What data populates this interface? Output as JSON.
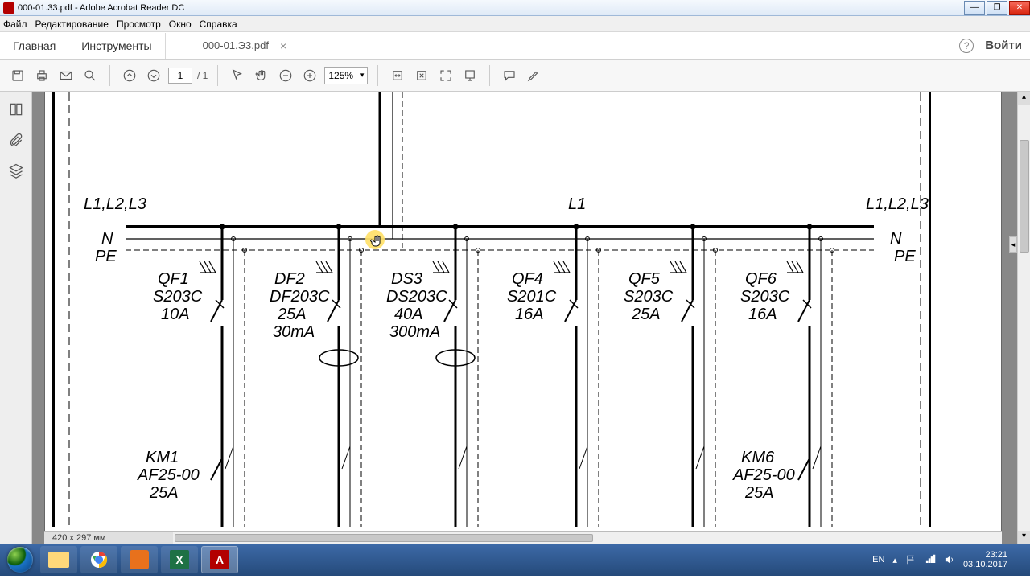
{
  "window": {
    "title": "000-01.33.pdf - Adobe Acrobat Reader DC"
  },
  "menu": {
    "file": "Файл",
    "edit": "Редактирование",
    "view": "Просмотр",
    "window": "Окно",
    "help": "Справка"
  },
  "tabs": {
    "home": "Главная",
    "tools": "Инструменты",
    "doc": "000-01.Э3.pdf",
    "login": "Войти"
  },
  "toolbar": {
    "page_current": "1",
    "page_total": "/ 1",
    "zoom": "125%"
  },
  "status": {
    "dimensions": "420 x 297 мм"
  },
  "diagram": {
    "phase_left": "L1,L2,L3",
    "neutral": "N",
    "ground": "PE",
    "phase_mid": "L1",
    "phase_right": "L1,L2,L3",
    "branches": [
      {
        "lab1": "QF1",
        "lab2": "S203C",
        "lab3": "10A",
        "lab4": ""
      },
      {
        "lab1": "DF2",
        "lab2": "DF203C",
        "lab3": "25A",
        "lab4": "30mA"
      },
      {
        "lab1": "DS3",
        "lab2": "DS203C",
        "lab3": "40A",
        "lab4": "300mA"
      },
      {
        "lab1": "QF4",
        "lab2": "S201C",
        "lab3": "16A",
        "lab4": ""
      },
      {
        "lab1": "QF5",
        "lab2": "S203C",
        "lab3": "25A",
        "lab4": ""
      },
      {
        "lab1": "QF6",
        "lab2": "S203C",
        "lab3": "16A",
        "lab4": ""
      }
    ],
    "contactors": {
      "km1": {
        "l1": "KM1",
        "l2": "AF25-00",
        "l3": "25A"
      },
      "km6": {
        "l1": "KM6",
        "l2": "AF25-00",
        "l3": "25A"
      }
    }
  },
  "systray": {
    "lang": "EN",
    "time": "23:21",
    "date": "03.10.2017"
  }
}
